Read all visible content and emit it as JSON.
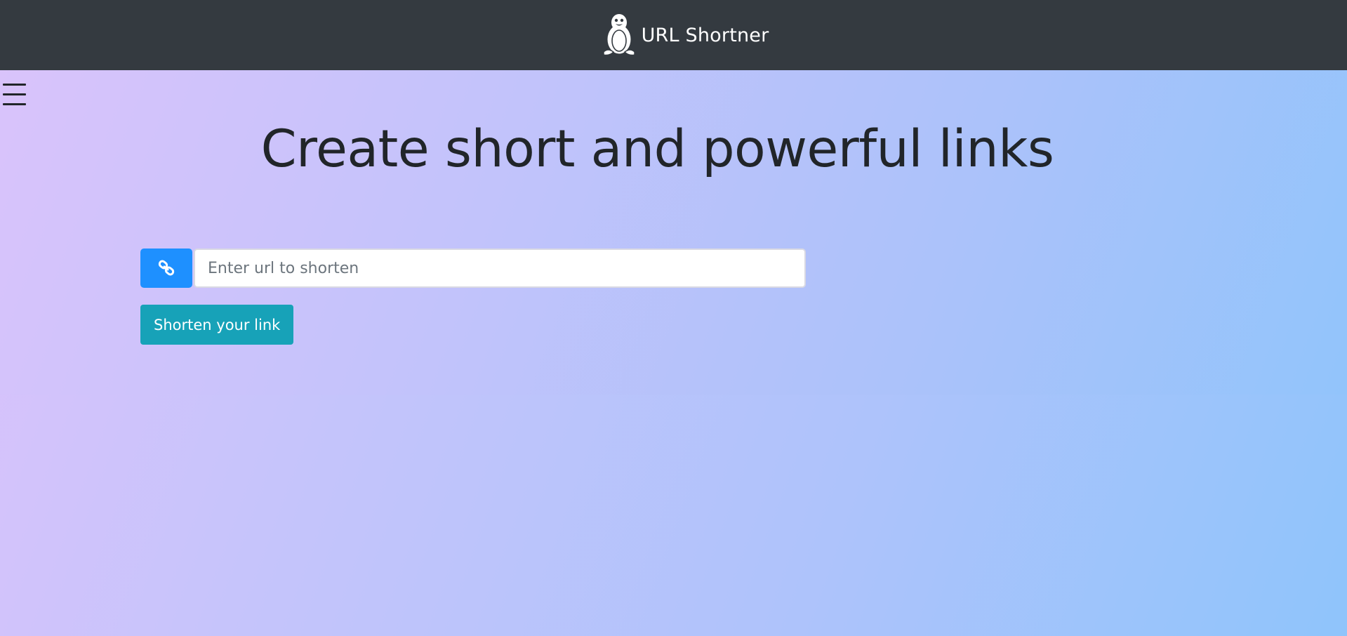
{
  "navbar": {
    "brand_title": "URL Shortner",
    "logo_icon": "penguin-icon",
    "background": "#343a40"
  },
  "hero": {
    "menu_icon": "hamburger-menu-icon",
    "title": "Create short and powerful links"
  },
  "form": {
    "link_icon": "link-icon",
    "url_input": {
      "value": "",
      "placeholder": "Enter url to shorten"
    },
    "submit_label": "Shorten your link"
  },
  "colors": {
    "icon_button": "#1e90ff",
    "submit_button": "#17a2b8",
    "title_text": "#212529"
  }
}
